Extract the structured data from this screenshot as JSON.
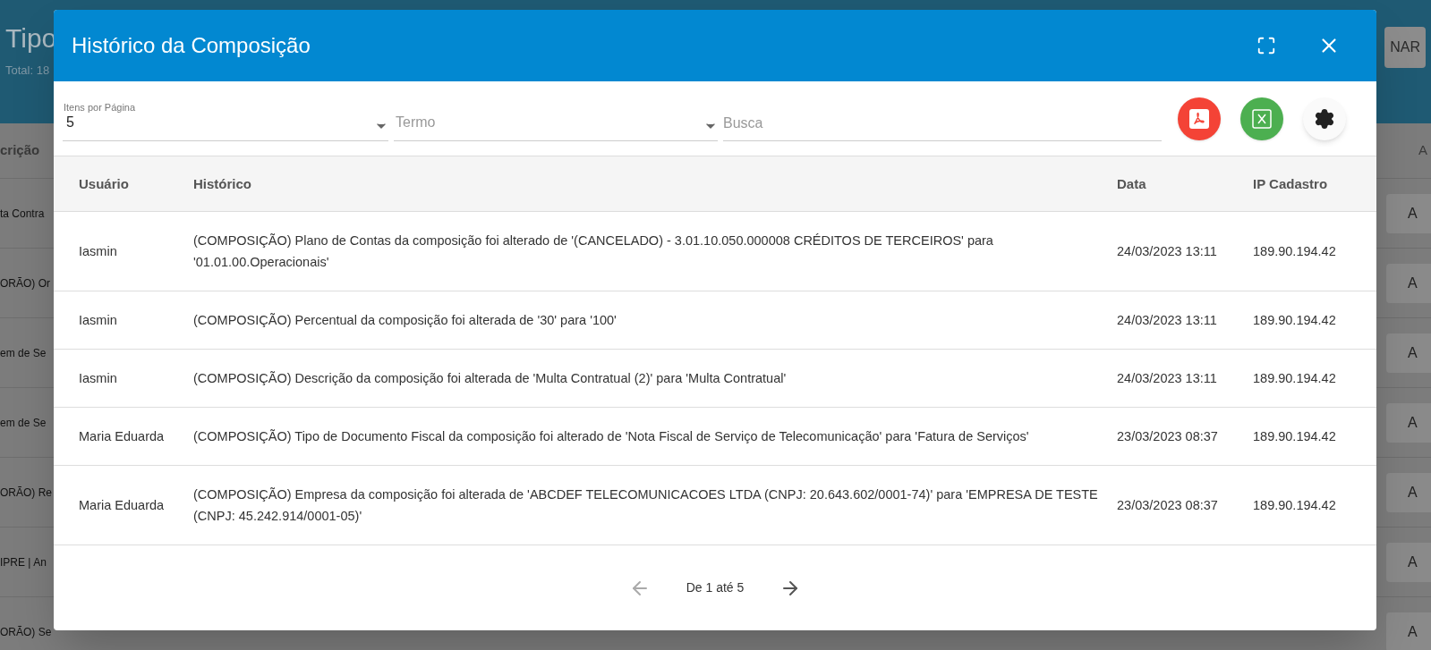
{
  "background_page": {
    "title": "Tipo",
    "subtitle": "Total: 18",
    "header_button": "NAR",
    "column_left": "crição",
    "column_right": "A",
    "rows": [
      {
        "text": "ta Contra",
        "action": "A"
      },
      {
        "text": "ORÃO) Or",
        "action": "A"
      },
      {
        "text": "em de Se",
        "action": "A"
      },
      {
        "text": "em de Se",
        "action": "A"
      },
      {
        "text": "ORÃO) Re",
        "action": "A"
      },
      {
        "text": "IPRE | An",
        "action": "A"
      },
      {
        "text": "ORÃO) Se",
        "action": "A"
      }
    ]
  },
  "dialog": {
    "title": "Histórico da Composição",
    "toolbar": {
      "items_per_page": {
        "label": "Itens por Página",
        "value": "5"
      },
      "term": {
        "placeholder": "Termo"
      },
      "search": {
        "placeholder": "Busca"
      }
    },
    "table": {
      "columns": [
        "Usuário",
        "Histórico",
        "Data",
        "IP Cadastro"
      ],
      "rows": [
        [
          "Iasmin",
          "(COMPOSIÇÃO) Plano de Contas da composição foi alterado de '(CANCELADO) - 3.01.10.050.000008 CRÉDITOS DE TERCEIROS' para '01.01.00.Operacionais'",
          "24/03/2023 13:11",
          "189.90.194.42"
        ],
        [
          "Iasmin",
          "(COMPOSIÇÃO) Percentual da composição foi alterada de '30' para '100'",
          "24/03/2023 13:11",
          "189.90.194.42"
        ],
        [
          "Iasmin",
          "(COMPOSIÇÃO) Descrição da composição foi alterada de 'Multa Contratual (2)' para 'Multa Contratual'",
          "24/03/2023 13:11",
          "189.90.194.42"
        ],
        [
          "Maria Eduarda",
          "(COMPOSIÇÃO) Tipo de Documento Fiscal da composição foi alterado de 'Nota Fiscal de Serviço de Telecomunicação' para 'Fatura de Serviços'",
          "23/03/2023 08:37",
          "189.90.194.42"
        ],
        [
          "Maria Eduarda",
          "(COMPOSIÇÃO) Empresa da composição foi alterada de 'ABCDEF TELECOMUNICACOES LTDA (CNPJ: 20.643.602/0001-74)' para 'EMPRESA DE TESTE (CNPJ: 45.242.914/0001-05)'",
          "23/03/2023 08:37",
          "189.90.194.42"
        ]
      ]
    },
    "pagination": {
      "label": "De 1 até 5"
    }
  }
}
